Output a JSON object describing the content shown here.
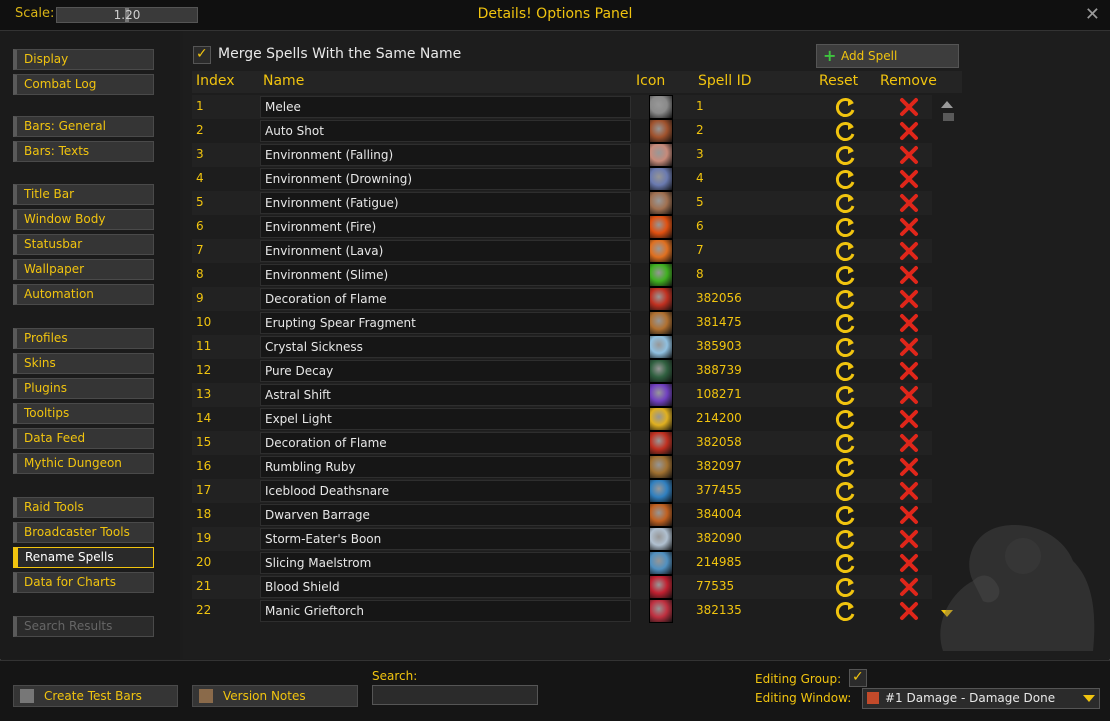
{
  "titlebar": {
    "scale_label": "Scale:",
    "scale_value": "1.20",
    "title": "Details! Options Panel",
    "close_icon": "close-icon"
  },
  "sidebar": {
    "groups": [
      [
        "Display",
        "Combat Log"
      ],
      [
        "Bars: General",
        "Bars: Texts"
      ],
      [
        "Title Bar",
        "Window Body",
        "Statusbar",
        "Wallpaper",
        "Automation"
      ],
      [
        "Profiles",
        "Skins",
        "Plugins",
        "Tooltips",
        "Data Feed",
        "Mythic Dungeon"
      ],
      [
        "Raid Tools",
        "Broadcaster Tools",
        "Rename Spells",
        "Data for Charts"
      ],
      [
        "Search Results"
      ]
    ],
    "active": "Rename Spells",
    "disabled": "Search Results"
  },
  "main": {
    "merge_label": "Merge Spells With the Same Name",
    "merge_checked": true,
    "add_spell_label": "Add Spell",
    "columns": [
      "Index",
      "Name",
      "Icon",
      "Spell ID",
      "Reset",
      "Remove"
    ],
    "rows": [
      {
        "index": "1",
        "name": "Melee",
        "icon": "sword-icon",
        "spell_id": "1",
        "color": "#8a8a8a"
      },
      {
        "index": "2",
        "name": "Auto Shot",
        "icon": "bow-icon",
        "spell_id": "2",
        "color": "#a0522d"
      },
      {
        "index": "3",
        "name": "Environment (Falling)",
        "icon": "falling-icon",
        "spell_id": "3",
        "color": "#c78a7a"
      },
      {
        "index": "4",
        "name": "Environment (Drowning)",
        "icon": "drowning-icon",
        "spell_id": "4",
        "color": "#6a7ab0"
      },
      {
        "index": "5",
        "name": "Environment (Fatigue)",
        "icon": "fatigue-icon",
        "spell_id": "5",
        "color": "#a07050"
      },
      {
        "index": "6",
        "name": "Environment (Fire)",
        "icon": "fire-icon",
        "spell_id": "6",
        "color": "#e05010"
      },
      {
        "index": "7",
        "name": "Environment (Lava)",
        "icon": "lava-icon",
        "spell_id": "7",
        "color": "#e07020"
      },
      {
        "index": "8",
        "name": "Environment (Slime)",
        "icon": "slime-icon",
        "spell_id": "8",
        "color": "#40b020"
      },
      {
        "index": "9",
        "name": "Decoration of Flame",
        "icon": "flame-decoration-icon",
        "spell_id": "382056",
        "color": "#c03020"
      },
      {
        "index": "10",
        "name": "Erupting Spear Fragment",
        "icon": "spear-fragment-icon",
        "spell_id": "381475",
        "color": "#b07030"
      },
      {
        "index": "11",
        "name": "Crystal Sickness",
        "icon": "crystal-icon",
        "spell_id": "385903",
        "color": "#90c0e0"
      },
      {
        "index": "12",
        "name": "Pure Decay",
        "icon": "decay-icon",
        "spell_id": "388739",
        "color": "#306040"
      },
      {
        "index": "13",
        "name": "Astral Shift",
        "icon": "astral-icon",
        "spell_id": "108271",
        "color": "#7040c0"
      },
      {
        "index": "14",
        "name": "Expel Light",
        "icon": "light-icon",
        "spell_id": "214200",
        "color": "#e0b020"
      },
      {
        "index": "15",
        "name": "Decoration of Flame",
        "icon": "flame-decoration-icon",
        "spell_id": "382058",
        "color": "#c03020"
      },
      {
        "index": "16",
        "name": "Rumbling Ruby",
        "icon": "ruby-icon",
        "spell_id": "382097",
        "color": "#a07030"
      },
      {
        "index": "17",
        "name": "Iceblood Deathsnare",
        "icon": "deathsnare-icon",
        "spell_id": "377455",
        "color": "#3080c0"
      },
      {
        "index": "18",
        "name": "Dwarven Barrage",
        "icon": "barrage-icon",
        "spell_id": "384004",
        "color": "#c06020"
      },
      {
        "index": "19",
        "name": "Storm-Eater's Boon",
        "icon": "storm-icon",
        "spell_id": "382090",
        "color": "#b0c0d0"
      },
      {
        "index": "20",
        "name": "Slicing Maelstrom",
        "icon": "maelstrom-icon",
        "spell_id": "214985",
        "color": "#5090c0"
      },
      {
        "index": "21",
        "name": "Blood Shield",
        "icon": "blood-shield-icon",
        "spell_id": "77535",
        "color": "#c02030"
      },
      {
        "index": "22",
        "name": "Manic Grieftorch",
        "icon": "grieftorch-icon",
        "spell_id": "382135",
        "color": "#c03040"
      }
    ]
  },
  "footer": {
    "create_test_bars": "Create Test Bars",
    "version_notes": "Version Notes",
    "search_label": "Search:",
    "search_value": "",
    "editing_group_label": "Editing Group:",
    "editing_group_checked": true,
    "editing_window_label": "Editing Window:",
    "editing_window_value": "#1 Damage - Damage Done"
  }
}
